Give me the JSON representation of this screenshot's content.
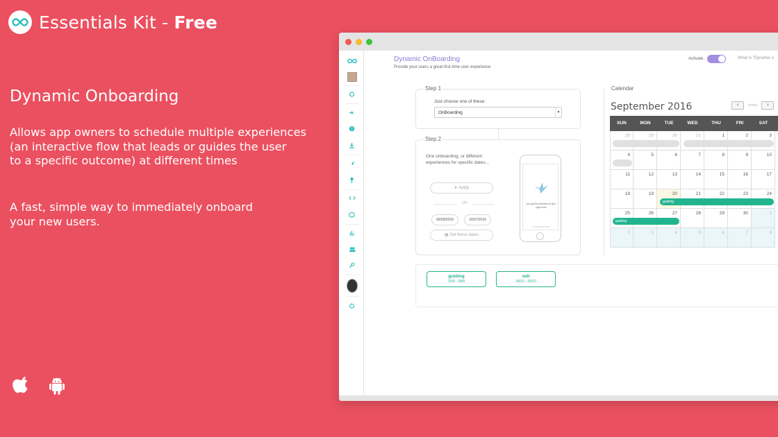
{
  "brand": {
    "title_prefix": "Essentials Kit - ",
    "title_bold": "Free",
    "logo_icon": "infinity-icon"
  },
  "hero": {
    "title": "Dynamic Onboarding",
    "paragraph1_lines": [
      "Allows app owners to schedule multiple experiences",
      "(an interactive flow that leads or guides the user",
      "to a specific outcome) at different times"
    ],
    "paragraph2_lines": [
      "A fast, simple way to immediately onboard",
      "your new users."
    ]
  },
  "platforms": [
    {
      "icon": "apple-icon"
    },
    {
      "icon": "android-icon"
    }
  ],
  "colors": {
    "background": "#eb5060",
    "accent_purple": "#8c7bd6",
    "event_green": "#22b48f"
  },
  "app": {
    "title": "Dynamic OnBoarding",
    "subtitle": "Provide your users a great first-time user experience",
    "activate_label": "Activate",
    "activate_on": true,
    "whatis_text": "What is \"Dynamic o",
    "step1": {
      "label": "Step 1",
      "choose_label": "Just choose one of these:",
      "selected": "OnBoarding"
    },
    "step2": {
      "label": "Step 2",
      "description": "One onboarding, or different experiences for specific dates...",
      "apply_label": "Apply",
      "or_label": "OR",
      "date_from": "09/28/2016",
      "date_to": "10/07/2016",
      "set_dates_label": "Set these dates",
      "phone_text": "you got the freedom to fly it right now!"
    },
    "calendar": {
      "label": "Calendar",
      "month": "September 2016",
      "prev_icon": "chevron-left-icon",
      "next_icon": "chevron-right-icon",
      "today_label": "today",
      "weekdays": [
        "SUN",
        "MON",
        "TUE",
        "WED",
        "THU",
        "FRI",
        "SAT"
      ],
      "weeks": [
        [
          "28",
          "29",
          "30",
          "31",
          "1",
          "2",
          "3"
        ],
        [
          "4",
          "5",
          "6",
          "7",
          "8",
          "9",
          "10"
        ],
        [
          "11",
          "12",
          "13",
          "14",
          "15",
          "16",
          "17"
        ],
        [
          "18",
          "19",
          "20",
          "21",
          "22",
          "23",
          "24"
        ],
        [
          "25",
          "26",
          "27",
          "28",
          "29",
          "30",
          "1"
        ],
        [
          "2",
          "3",
          "4",
          "5",
          "6",
          "7",
          "8"
        ]
      ],
      "events": [
        {
          "name": "guiding"
        },
        {
          "name": "guiding"
        }
      ]
    },
    "experiences": [
      {
        "name": "guiding",
        "range": "20/9 - 28/9"
      },
      {
        "name": "sell",
        "range": "24/10 - 25/10"
      }
    ]
  }
}
